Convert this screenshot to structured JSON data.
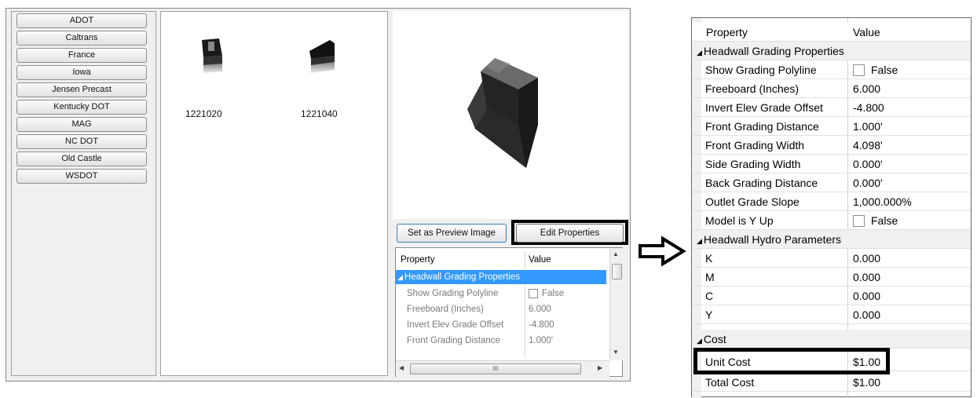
{
  "agencies": [
    "ADOT",
    "Caltrans",
    "France",
    "Iowa",
    "Jensen Precast",
    "Kentucky DOT",
    "MAG",
    "NC DOT",
    "Old Castle",
    "WSDOT"
  ],
  "thumbnails": [
    {
      "label": "1221020",
      "icon": "headwall-cube-icon"
    },
    {
      "label": "1221040",
      "icon": "headwall-wedge-icon"
    }
  ],
  "preview": {
    "icon": "headwall-3d-preview"
  },
  "buttons": {
    "set_preview": "Set as Preview Image",
    "edit_properties": "Edit Properties"
  },
  "small_grid": {
    "header": {
      "property": "Property",
      "value": "Value"
    },
    "category": "Headwall Grading Properties",
    "rows": [
      {
        "name": "Show Grading Polyline",
        "value": "False"
      },
      {
        "name": "Freeboard (Inches)",
        "value": "6.000"
      },
      {
        "name": "Invert Elev Grade Offset",
        "value": "-4.800"
      },
      {
        "name": "Front Grading Distance",
        "value": "1.000'"
      }
    ],
    "hscroll_grip": "III"
  },
  "big_grid": {
    "header": {
      "property": "Property",
      "value": "Value"
    },
    "grading": {
      "title": "Headwall Grading Properties",
      "rows": [
        {
          "name": "Show Grading Polyline",
          "value": "False"
        },
        {
          "name": "Freeboard (Inches)",
          "value": "6.000"
        },
        {
          "name": "Invert Elev Grade Offset",
          "value": "-4.800"
        },
        {
          "name": "Front Grading Distance",
          "value": "1.000'"
        },
        {
          "name": "Front Grading Width",
          "value": "4.098'"
        },
        {
          "name": "Side Grading Width",
          "value": "0.000'"
        },
        {
          "name": "Back Grading Distance",
          "value": "0.000'"
        },
        {
          "name": "Outlet Grade Slope",
          "value": "1,000.000%"
        },
        {
          "name": "Model is Y Up",
          "value": "False"
        }
      ]
    },
    "hydro": {
      "title": "Headwall Hydro Parameters",
      "rows": [
        {
          "name": "K",
          "value": "0.000"
        },
        {
          "name": "M",
          "value": "0.000"
        },
        {
          "name": "C",
          "value": "0.000"
        },
        {
          "name": "Y",
          "value": "0.000"
        }
      ]
    },
    "cost": {
      "title": "Cost",
      "rows": [
        {
          "name": "Unit Cost",
          "value": "$1.00"
        },
        {
          "name": "Total Cost",
          "value": "$1.00"
        }
      ]
    }
  }
}
